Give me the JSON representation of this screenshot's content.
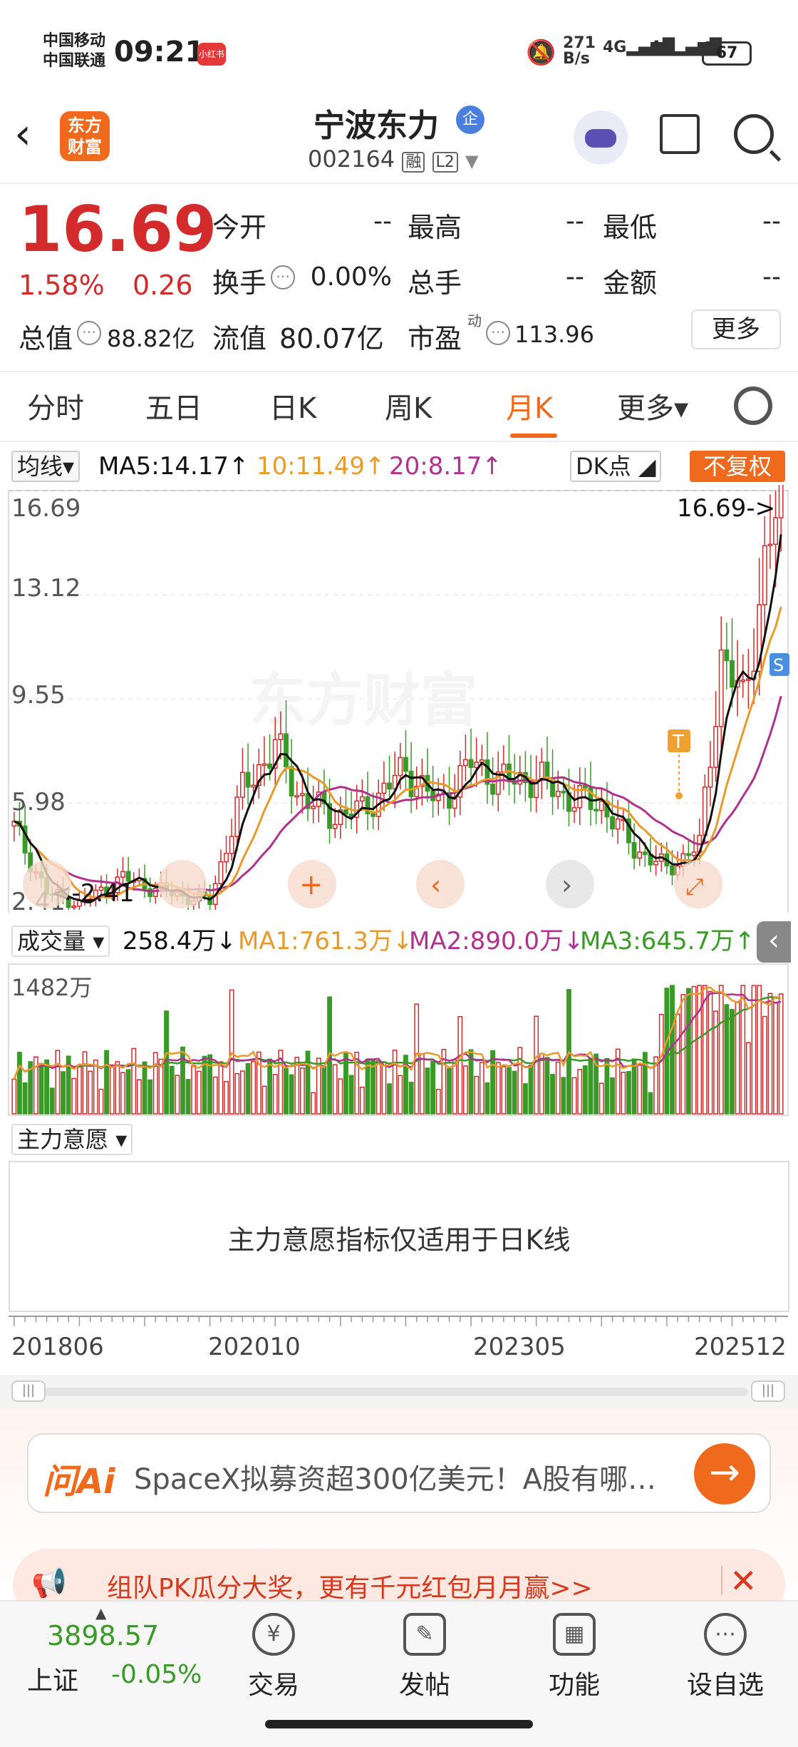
{
  "status": {
    "carrier1": "中国移动",
    "carrier2": "中国联通",
    "time": "09:21",
    "app_badge": "小红书",
    "net_speed": "271",
    "net_unit": "B/s",
    "sig1": "4G",
    "sig2": "4G",
    "battery": "67"
  },
  "header": {
    "logo_line1": "东方",
    "logo_line2": "财富",
    "stock_name": "宁波东力",
    "qi_badge": "企",
    "stock_code": "002164",
    "tag_rong": "融",
    "tag_l2": "L2"
  },
  "quote": {
    "price": "16.69",
    "pct": "1.58%",
    "change": "0.26",
    "open_label": "今开",
    "open": "--",
    "high_label": "最高",
    "high": "--",
    "low_label": "最低",
    "low": "--",
    "turnover_label": "换手",
    "turnover": "0.00%",
    "vol_label": "总手",
    "vol": "--",
    "amount_label": "金额",
    "amount": "--",
    "mcap_label": "总值",
    "mcap": "88.82亿",
    "float_label": "流值",
    "float": "80.07亿",
    "pe_label": "市盈",
    "pe_sup": "动",
    "pe": "113.96",
    "more": "更多"
  },
  "tabs": [
    "分时",
    "五日",
    "日K",
    "周K",
    "月K",
    "更多▾"
  ],
  "active_tab": "月K",
  "ma": {
    "select": "均线",
    "ma5": "MA5:14.17↑",
    "ma10": "10:11.49↑",
    "ma20": "20:8.17↑",
    "dk": "DK点",
    "fq": "不复权"
  },
  "kline": {
    "y_labels": [
      "16.69",
      "13.12",
      "9.55",
      "5.98",
      "2.41"
    ],
    "max_label": "16.69->",
    "min_label": "<-2.41",
    "marker_t": "T",
    "marker_s": "S",
    "watermark": "东方财富"
  },
  "volume": {
    "select": "成交量",
    "vol": "258.4万↓",
    "ma1": "MA1:761.3万↓",
    "ma2": "MA2:890.0万↓",
    "ma3": "MA3:645.7万↑",
    "max_label": "1482万"
  },
  "zhuli": {
    "select": "主力意愿",
    "note": "主力意愿指标仅适用于日K线"
  },
  "x_axis": [
    "201806",
    "202010",
    "202305",
    "202512"
  ],
  "ai": {
    "brand": "问Ai",
    "text": "SpaceX拟募资超300亿美元！A股有哪…"
  },
  "banner": {
    "text": "组队PK瓜分大奖，更有千元红包月月赢>>"
  },
  "nav": {
    "index_value": "3898.57",
    "index_name": "上证",
    "index_change": "-0.05%",
    "items": [
      "交易",
      "发帖",
      "功能",
      "设自选"
    ]
  },
  "colors": {
    "up": "#d32b2b",
    "down": "#3a9a28",
    "accent": "#f06a1d",
    "ma5": "#111111",
    "ma10": "#e89a2a",
    "ma20": "#b0328c"
  }
}
